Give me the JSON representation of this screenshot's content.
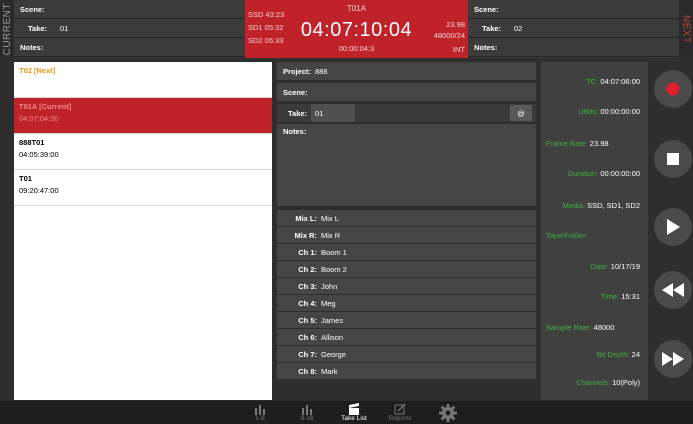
{
  "current_label": "CURRENT",
  "next_label": "NEXT",
  "current": {
    "scene_label": "Scene:",
    "scene_value": "",
    "take_label": "Take:",
    "take_value": "01",
    "notes_label": "Notes:",
    "notes_value": ""
  },
  "next": {
    "scene_label": "Scene:",
    "scene_value": "",
    "take_label": "Take:",
    "take_value": "02",
    "notes_label": "Notes:",
    "notes_value": ""
  },
  "status": {
    "clip_name": "T01A",
    "timecode": "04:07:10:04",
    "elapsed": "00:00:04:3",
    "media": [
      "SSD 43:23",
      "SD1 05:32",
      "SD2 05:33"
    ],
    "frame_rate": "23.98",
    "sample_rate": "48000/24",
    "sync": "INT",
    "color": "#c0222a"
  },
  "takes": [
    {
      "name": "T02 [Next]",
      "time": "",
      "state": "next"
    },
    {
      "name": "T01A [Current]",
      "time": "04:07:04:00",
      "state": "current"
    },
    {
      "name": "888T01",
      "time": "04:05:39:00",
      "state": "normal"
    },
    {
      "name": "T01",
      "time": "09:20:47:00",
      "state": "normal"
    }
  ],
  "meta": {
    "project_label": "Project:",
    "project_value": "888",
    "scene_label": "Scene:",
    "scene_value": "",
    "take_label": "Take:",
    "take_value": "01",
    "at_label": "@",
    "notes_label": "Notes:",
    "notes_value": ""
  },
  "channels": [
    {
      "label": "Mix L:",
      "value": "Mix L"
    },
    {
      "label": "Mix R:",
      "value": "Mix R"
    },
    {
      "label": "Ch 1:",
      "value": "Boom 1"
    },
    {
      "label": "Ch 2:",
      "value": "Boom 2"
    },
    {
      "label": "Ch 3:",
      "value": "John"
    },
    {
      "label": "Ch 4:",
      "value": "Meg"
    },
    {
      "label": "Ch 5:",
      "value": "James"
    },
    {
      "label": "Ch 6:",
      "value": "Allison"
    },
    {
      "label": "Ch 7:",
      "value": "George"
    },
    {
      "label": "Ch 8:",
      "value": "Mark"
    }
  ],
  "info": [
    {
      "key": "TC:",
      "value": "04:07:06:00"
    },
    {
      "key": "UBits:",
      "value": "00:00:00:00"
    },
    {
      "key": "Frame Rate:",
      "value": "23.98"
    },
    {
      "key": "Duration:",
      "value": "00:00:00:00"
    },
    {
      "key": "Media:",
      "value": "SSD, SD1, SD2"
    },
    {
      "key": "Tape/Folder:",
      "value": ""
    },
    {
      "key": "Date:",
      "value": "10/17/19"
    },
    {
      "key": "Time:",
      "value": "15:31"
    },
    {
      "key": "Sample Rate:",
      "value": "48000"
    },
    {
      "key": "Bit Depth:",
      "value": "24"
    },
    {
      "key": "Channels:",
      "value": "10(Poly)"
    }
  ],
  "transport": [
    "record-icon",
    "stop-icon",
    "play-icon",
    "rewind-icon",
    "fast-forward-icon"
  ],
  "record_color": "#e0202a",
  "accent_green": "#3fae3f",
  "nav": [
    {
      "label": "1-8",
      "icon": "meter-icon",
      "active": false
    },
    {
      "label": "9-16",
      "icon": "meter-icon",
      "active": false
    },
    {
      "label": "Take List",
      "icon": "clapper-icon",
      "active": true
    },
    {
      "label": "Reports",
      "icon": "edit-icon",
      "active": false
    },
    {
      "label": "",
      "icon": "gear-icon",
      "active": false
    }
  ]
}
